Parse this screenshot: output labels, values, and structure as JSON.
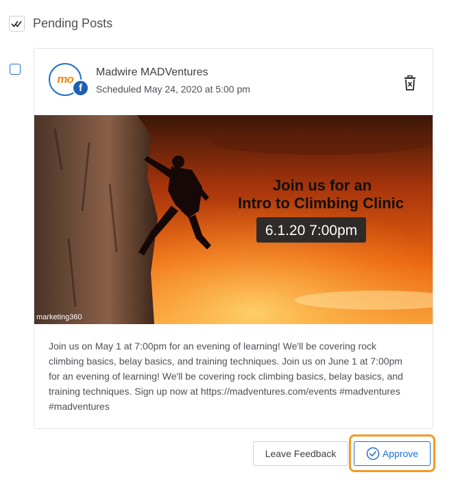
{
  "header": {
    "title": "Pending Posts"
  },
  "post": {
    "account_name": "Madwire MADVentures",
    "scheduled": "Scheduled May 24, 2020 at 5:00 pm",
    "avatar_logo_text": "mo",
    "network_icon": "facebook-icon",
    "image": {
      "headline_line1": "Join us for an",
      "headline_line2": "Intro to Climbing Clinic",
      "date_badge": "6.1.20 7:00pm",
      "watermark": "marketing360"
    },
    "body": "Join us on May 1 at 7:00pm for an evening of learning! We'll be covering rock climbing basics, belay basics, and training techniques. Join us on June 1 at 7:00pm for an evening of learning! We'll be covering rock climbing basics, belay basics, and training techniques. Sign up now at https://madventures.com/events #madventures #madventures"
  },
  "actions": {
    "feedback_label": "Leave Feedback",
    "approve_label": "Approve"
  },
  "colors": {
    "accent": "#1f6fd1",
    "highlight": "#f39a1e",
    "facebook": "#1d5fb3"
  }
}
